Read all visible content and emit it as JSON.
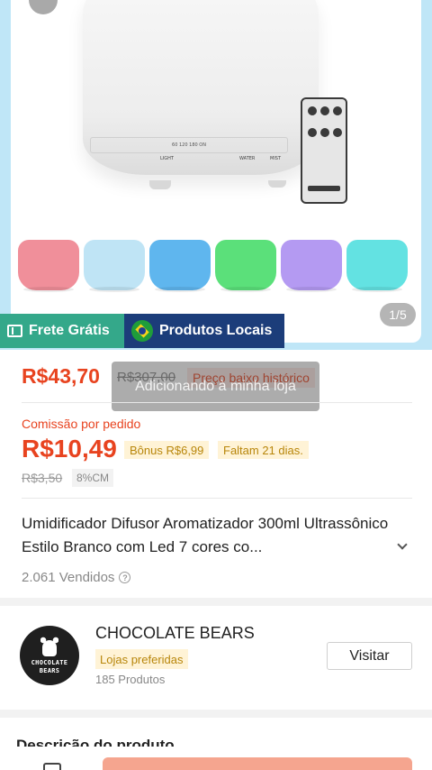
{
  "gallery": {
    "counter": "1/5",
    "variant_colors": [
      "#f08f9a",
      "#bfe4f5",
      "#5fb6ee",
      "#5be07a",
      "#b49af2",
      "#63e2e2"
    ],
    "diffuser_labels": [
      "LIGHT",
      "WATER",
      "MIST"
    ],
    "diffuser_panel_text": "60  120  180  ON"
  },
  "badges": {
    "free_shipping": "Frete Grátis",
    "local_products": "Produtos Locais"
  },
  "price": {
    "current": "R$43,70",
    "original": "R$307,00",
    "tag": "Preço baixo histórico"
  },
  "toast": "Adicionando à minha loja",
  "commission": {
    "label": "Comissão por pedido",
    "value": "R$10,49",
    "bonus": "Bônus R$6,99",
    "days_left": "Faltam 21 dias.",
    "old_value": "R$3,50",
    "rate": "8%CM"
  },
  "product": {
    "title": "Umidificador Difusor Aromatizador 300ml Ultrassônico Estilo Branco com Led 7 cores co...",
    "sold": "2.061 Vendidos"
  },
  "shop": {
    "logo_text_1": "CHOCOLATE",
    "logo_text_2": "BEARS",
    "name": "CHOCOLATE BEARS",
    "tag": "Lojas preferidas",
    "products": "185 Produtos",
    "visit_label": "Visitar"
  },
  "next_section": "Descrição do produto",
  "colors": {
    "accent": "#e8431f",
    "frete_badge": "#34a88a",
    "local_badge": "#1c3d7a",
    "cta": "#f5a58f"
  }
}
